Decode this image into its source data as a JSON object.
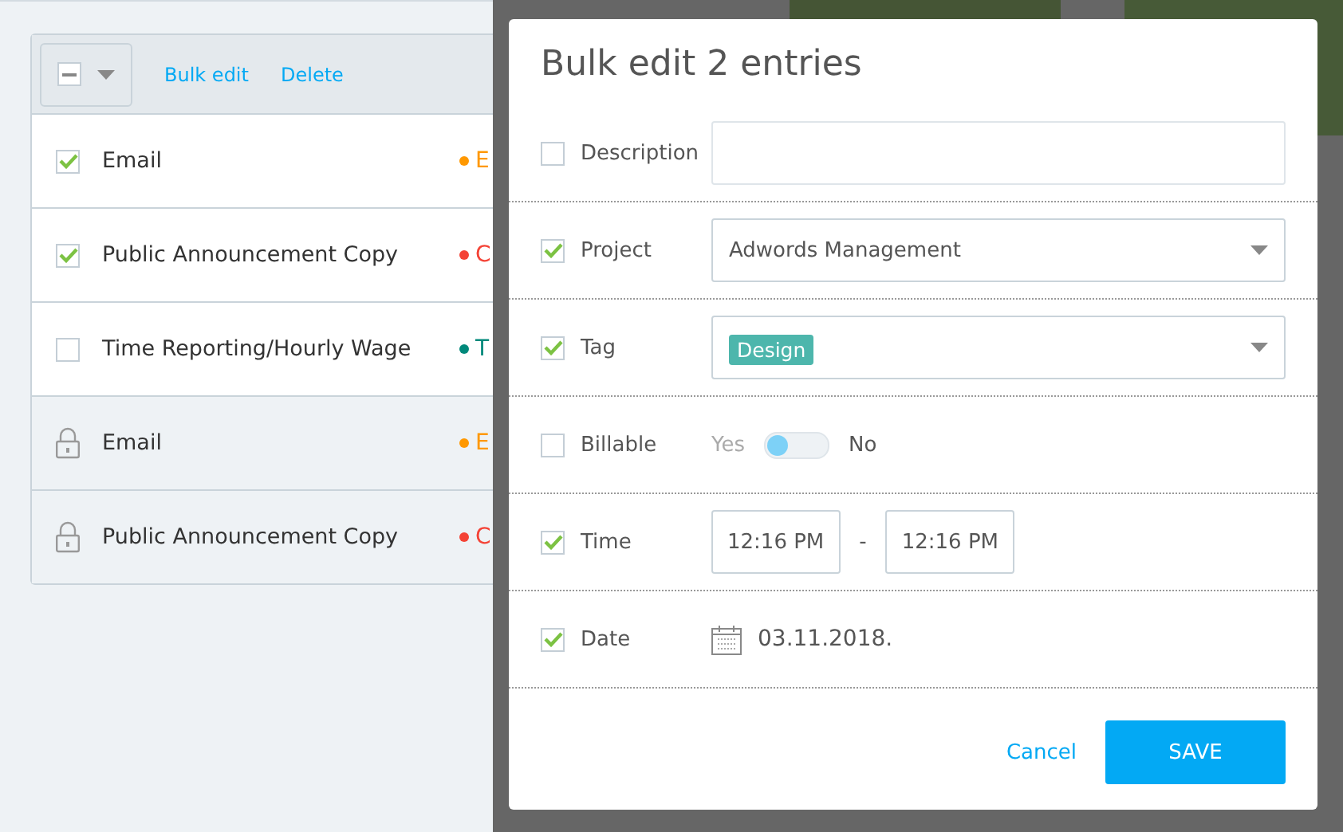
{
  "toolbar": {
    "select_all": {
      "indeterminate": true
    },
    "actions": [
      "Bulk edit",
      "Delete"
    ]
  },
  "entries": [
    {
      "kind": "checkbox",
      "checked": true,
      "description": "Email",
      "project": "E",
      "color": "#ff9800"
    },
    {
      "kind": "checkbox",
      "checked": true,
      "description": "Public Announcement Copy",
      "project": "C",
      "color": "#f44336"
    },
    {
      "kind": "checkbox",
      "checked": false,
      "description": "Time Reporting/Hourly Wage",
      "project": "T",
      "color": "#00897b"
    },
    {
      "kind": "locked",
      "description": "Email",
      "project": "E",
      "color": "#ff9800"
    },
    {
      "kind": "locked",
      "description": "Public Announcement Copy",
      "project": "C",
      "color": "#f44336"
    }
  ],
  "modal": {
    "title": "Bulk edit 2 entries",
    "fields": [
      {
        "kind": "text",
        "label": "Description",
        "checked": false
      },
      {
        "kind": "select",
        "label": "Project",
        "checked": true,
        "value": "Adwords Management"
      },
      {
        "kind": "tags",
        "label": "Tag",
        "checked": true,
        "tags": [
          {
            "label": "Design",
            "color": "#4db6ac"
          }
        ]
      },
      {
        "kind": "toggle",
        "label": "Billable",
        "checked": false,
        "on_label": "Yes",
        "off_label": "No",
        "on": false
      },
      {
        "kind": "time",
        "label": "Time",
        "checked": true,
        "start": "12:16 PM",
        "separator": "-",
        "end": "12:16 PM"
      },
      {
        "kind": "date",
        "label": "Date",
        "checked": true,
        "value": "03.11.2018."
      }
    ],
    "cancel": "Cancel",
    "save": "SAVE"
  }
}
